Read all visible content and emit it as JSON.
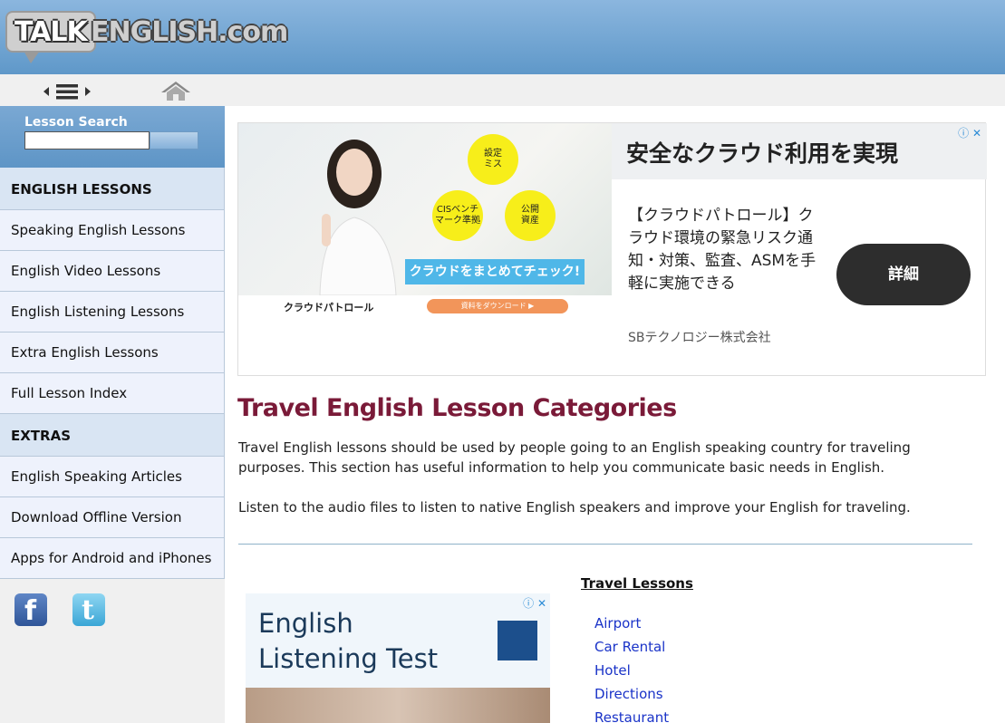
{
  "header": {
    "logo_talk": "TALK",
    "logo_english": "ENGLISH.com"
  },
  "toolbar": {
    "menu_icon": "menu-arrows-icon",
    "home_icon": "home-icon"
  },
  "sidebar": {
    "search_label": "Lesson Search",
    "search_value": "",
    "sections": [
      {
        "heading": "ENGLISH LESSONS",
        "items": [
          "Speaking English Lessons",
          "English Video Lessons",
          "English Listening Lessons",
          "Extra English Lessons",
          "Full Lesson Index"
        ]
      },
      {
        "heading": "EXTRAS",
        "items": [
          "English Speaking Articles",
          "Download Offline Version",
          "Apps for Android and iPhones"
        ]
      }
    ],
    "social": [
      "facebook-icon",
      "twitter-icon"
    ]
  },
  "ad_top": {
    "bubbles": [
      "設定\nミス",
      "CISベンチ\nマーク準拠",
      "公開\n資産"
    ],
    "check_label": "クラウドをまとめてチェック!",
    "brand": "クラウドパトロール",
    "download_label": "資料をダウンロード ▶",
    "headline": "安全なクラウド利用を実現",
    "body": "【クラウドパトロール】クラウド環境の緊急リスク通知・対策、監査、ASMを手軽に実施できる",
    "company": "SBテクノロジー株式会社",
    "cta": "詳細"
  },
  "main": {
    "title": "Travel English Lesson Categories",
    "para1": "Travel English lessons should be used by people going to an English speaking country for traveling purposes. This section has useful information to help you communicate basic needs in English.",
    "para2": "Listen to the audio files to listen to native English speakers and improve your English for traveling."
  },
  "ad_bottom": {
    "line1": "English",
    "line2": "Listening Test"
  },
  "lessons": {
    "title": "Travel Lessons",
    "items": [
      "Airport",
      "Car Rental",
      "Hotel",
      "Directions",
      "Restaurant"
    ]
  }
}
